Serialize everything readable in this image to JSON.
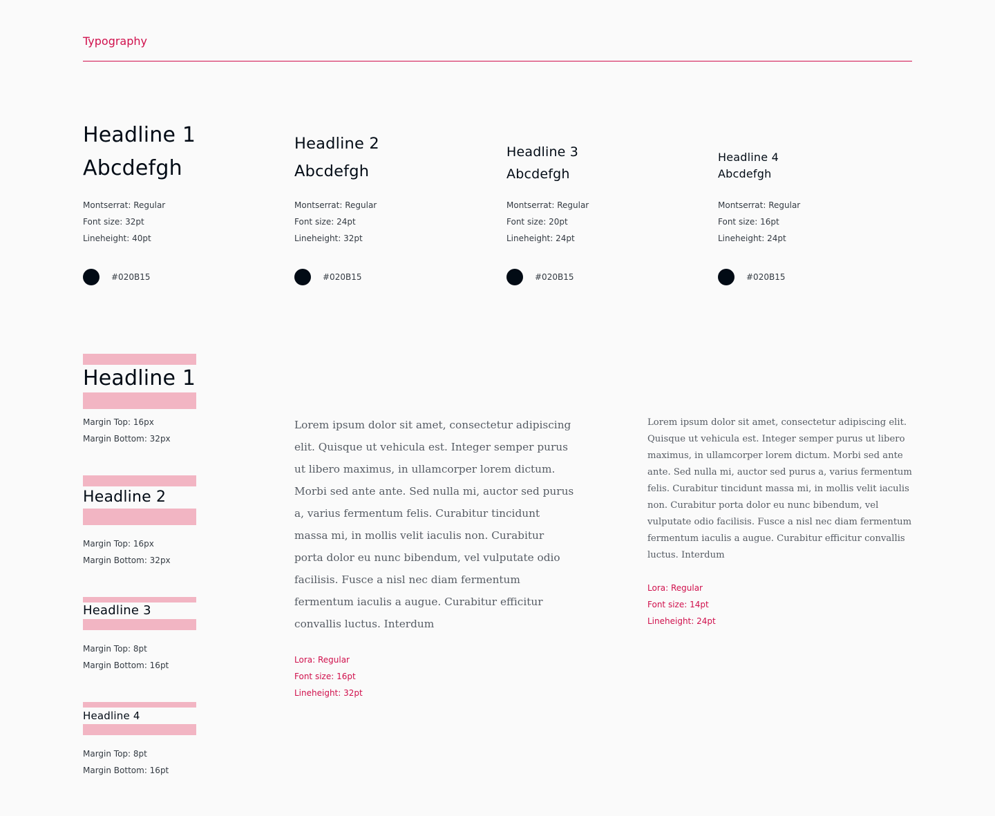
{
  "header": {
    "title": "Typography",
    "accent_color": "#D0104C"
  },
  "headlines": [
    {
      "line1": "Headline 1",
      "line2": "Abcdefgh",
      "font": "Montserrat: Regular",
      "size": "Font size: 32pt",
      "lineheight": "Lineheight: 40pt",
      "color_hex": "#020B15",
      "color_label": "#020B15"
    },
    {
      "line1": "Headline 2",
      "line2": "Abcdefgh",
      "font": "Montserrat: Regular",
      "size": "Font size: 24pt",
      "lineheight": "Lineheight: 32pt",
      "color_hex": "#020B15",
      "color_label": "#020B15"
    },
    {
      "line1": "Headline 3",
      "line2": "Abcdefgh",
      "font": "Montserrat: Regular",
      "size": "Font size: 20pt",
      "lineheight": "Lineheight: 24pt",
      "color_hex": "#020B15",
      "color_label": "#020B15"
    },
    {
      "line1": "Headline 4",
      "line2": "Abcdefgh",
      "font": "Montserrat: Regular",
      "size": "Font size: 16pt",
      "lineheight": "Lineheight: 24pt",
      "color_hex": "#020B15",
      "color_label": "#020B15"
    }
  ],
  "spacing": {
    "bar_color": "#F2B5C3",
    "items": [
      {
        "label": "Headline 1",
        "margin_top": "Margin Top: 16px",
        "margin_bottom": "Margin Bottom: 32px"
      },
      {
        "label": "Headline 2",
        "margin_top": "Margin Top: 16px",
        "margin_bottom": "Margin Bottom: 32px"
      },
      {
        "label": "Headline 3",
        "margin_top": "Margin Top: 8pt",
        "margin_bottom": "Margin Bottom: 16pt"
      },
      {
        "label": "Headline 4",
        "margin_top": "Margin Top: 8pt",
        "margin_bottom": "Margin Bottom: 16pt"
      }
    ]
  },
  "body_large": {
    "lines": [
      "Lorem ipsum dolor sit amet, consectetur adipiscing",
      "elit. Quisque ut vehicula est. Integer semper purus",
      "ut libero maximus, in ullamcorper lorem dictum.",
      "Morbi sed ante ante. Sed nulla mi, auctor sed purus",
      "a, varius fermentum felis. Curabitur tincidunt",
      "massa mi, in mollis velit iaculis non. Curabitur",
      "porta dolor eu nunc bibendum, vel vulputate odio",
      "facilisis. Fusce a nisl nec diam fermentum",
      "fermentum iaculis a augue. Curabitur efficitur",
      "convallis luctus. Interdum"
    ],
    "font": "Lora: Regular",
    "size": "Font size: 16pt",
    "lineheight": "Lineheight: 32pt"
  },
  "body_small": {
    "lines": [
      "Lorem ipsum dolor sit amet, consectetur adipiscing elit.",
      "Quisque ut vehicula est. Integer semper purus ut libero",
      "maximus, in ullamcorper lorem dictum. Morbi sed ante",
      "ante. Sed nulla mi, auctor sed purus a, varius fermentum",
      "felis. Curabitur tincidunt massa mi, in mollis velit iaculis",
      "non. Curabitur porta dolor eu nunc bibendum, vel",
      "vulputate odio facilisis. Fusce a nisl nec diam fermentum",
      "fermentum iaculis a augue. Curabitur efficitur convallis",
      "luctus. Interdum"
    ],
    "font": "Lora: Regular",
    "size": "Font size: 14pt",
    "lineheight": "Lineheight: 24pt"
  }
}
